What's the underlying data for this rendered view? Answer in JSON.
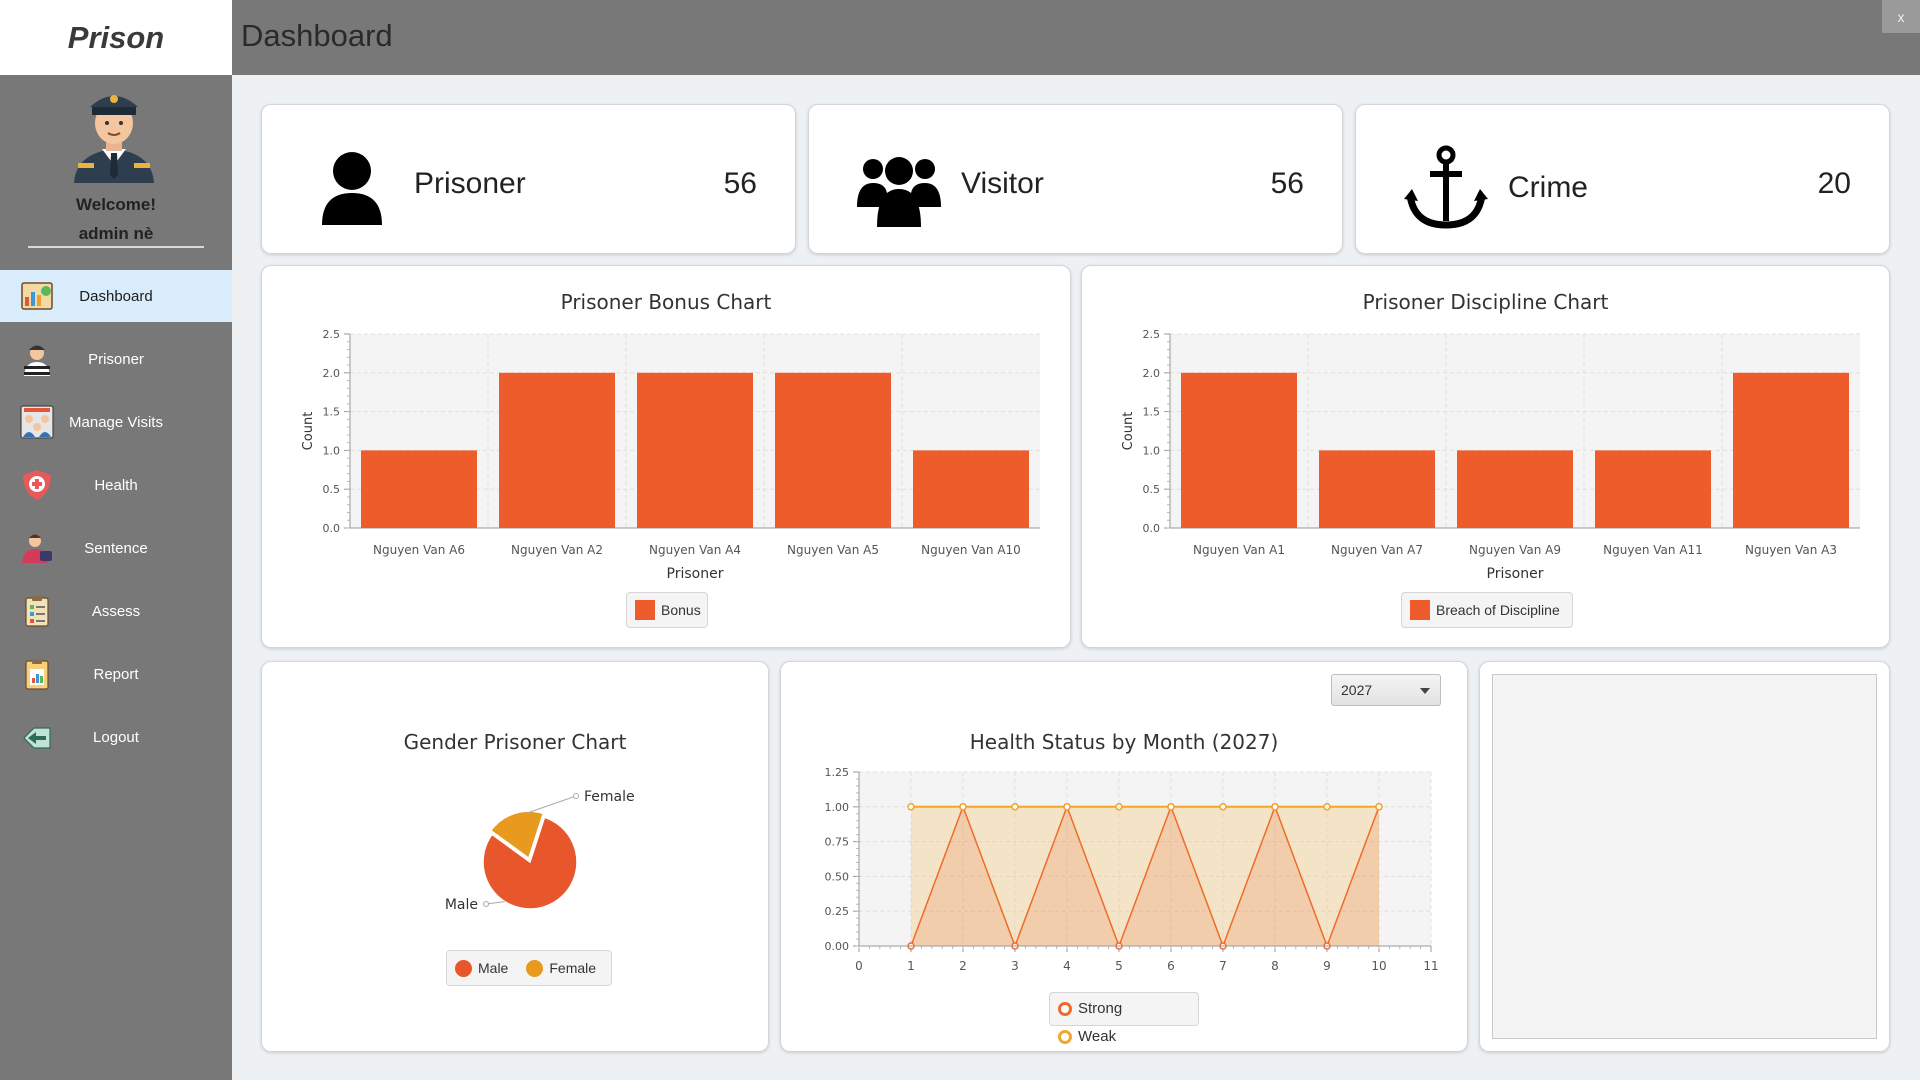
{
  "app": {
    "brand": "Prison",
    "page_title": "Dashboard",
    "close_label": "x"
  },
  "profile": {
    "welcome": "Welcome!",
    "user": "admin nè"
  },
  "sidebar": {
    "items": [
      {
        "label": "Dashboard",
        "icon": "dashboard-icon",
        "active": true
      },
      {
        "label": "Prisoner",
        "icon": "prisoner-icon"
      },
      {
        "label": "Manage Visits",
        "icon": "visits-icon"
      },
      {
        "label": "Health",
        "icon": "health-shield-icon"
      },
      {
        "label": "Sentence",
        "icon": "sentence-icon"
      },
      {
        "label": "Assess",
        "icon": "assess-clipboard-icon"
      },
      {
        "label": "Report",
        "icon": "report-clipboard-icon"
      },
      {
        "label": "Logout",
        "icon": "logout-icon"
      }
    ]
  },
  "stats": [
    {
      "label": "Prisoner",
      "value": "56",
      "icon": "person-icon"
    },
    {
      "label": "Visitor",
      "value": "56",
      "icon": "group-icon"
    },
    {
      "label": "Crime",
      "value": "20",
      "icon": "anchor-icon"
    }
  ],
  "colors": {
    "bar": "#ef5c2b",
    "strong": "#f06a2a",
    "weak": "#f2a72a",
    "male": "#e8562c",
    "female": "#e89a1f"
  },
  "chart_data": [
    {
      "type": "bar",
      "title": "Prisoner Bonus Chart",
      "xlabel": "Prisoner",
      "ylabel": "Count",
      "categories": [
        "Nguyen Van A6",
        "Nguyen Van A2",
        "Nguyen Van A4",
        "Nguyen Van A5",
        "Nguyen Van A10"
      ],
      "series": [
        {
          "name": "Bonus",
          "values": [
            1,
            2,
            2,
            2,
            1
          ]
        }
      ],
      "ylim": [
        0,
        2.5
      ],
      "yticks": [
        "0.0",
        "0.5",
        "1.0",
        "1.5",
        "2.0",
        "2.5"
      ],
      "legend": "bottom"
    },
    {
      "type": "bar",
      "title": "Prisoner Discipline Chart",
      "xlabel": "Prisoner",
      "ylabel": "Count",
      "categories": [
        "Nguyen Van A1",
        "Nguyen Van A7",
        "Nguyen Van A9",
        "Nguyen Van A11",
        "Nguyen Van A3"
      ],
      "series": [
        {
          "name": "Breach of Discipline",
          "values": [
            2,
            1,
            1,
            1,
            2
          ]
        }
      ],
      "ylim": [
        0,
        2.5
      ],
      "yticks": [
        "0.0",
        "0.5",
        "1.0",
        "1.5",
        "2.0",
        "2.5"
      ],
      "legend": "bottom"
    },
    {
      "type": "pie",
      "title": "Gender Prisoner Chart",
      "labels": [
        "Male",
        "Female"
      ],
      "values": [
        80,
        20
      ],
      "legend": "bottom"
    },
    {
      "type": "area",
      "title": "Health Status by Month (2027)",
      "x": [
        1,
        2,
        3,
        4,
        5,
        6,
        7,
        8,
        9,
        10
      ],
      "series": [
        {
          "name": "Strong",
          "values": [
            0,
            1,
            0,
            1,
            0,
            1,
            0,
            1,
            0,
            1
          ]
        },
        {
          "name": "Weak",
          "values": [
            1,
            1,
            1,
            1,
            1,
            1,
            1,
            1,
            1,
            1
          ]
        }
      ],
      "xlim": [
        0,
        11
      ],
      "ylim": [
        0,
        1.25
      ],
      "xticks": [
        "0",
        "1",
        "2",
        "3",
        "4",
        "5",
        "6",
        "7",
        "8",
        "9",
        "10",
        "11"
      ],
      "yticks": [
        "0.00",
        "0.25",
        "0.50",
        "0.75",
        "1.00",
        "1.25"
      ],
      "legend": "bottom"
    }
  ],
  "health_filter": {
    "selected": "2027"
  }
}
